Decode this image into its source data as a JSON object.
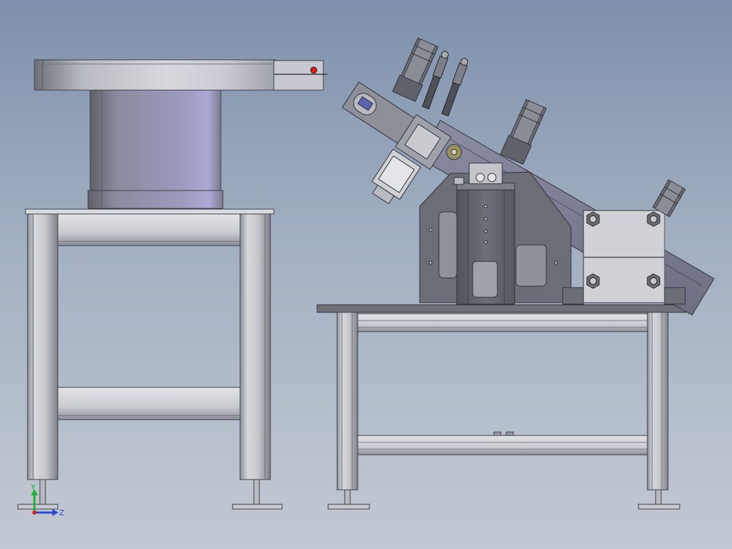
{
  "window": {
    "title": ""
  },
  "viewport": {
    "background_top": "#7e90ab",
    "background_bottom": "#c3c9d2"
  },
  "colors": {
    "metal_light": "#cfd3da",
    "metal_dark": "#5c606a",
    "frame": "#b9bcc3",
    "cylinder": "#9697b5",
    "accent_red": "#d62020"
  },
  "triad": {
    "y_label": "Y",
    "z_label": "Z",
    "y_color": "#1fae2e",
    "z_color": "#2846d8",
    "x_color": "#d62020"
  }
}
